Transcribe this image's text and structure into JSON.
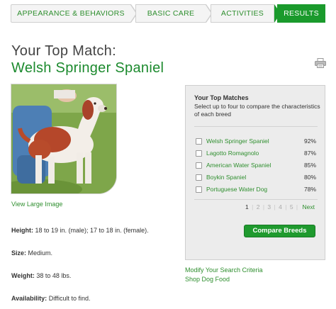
{
  "steps": [
    {
      "label": "Appearance & Behaviors"
    },
    {
      "label": "Basic Care"
    },
    {
      "label": "Activities"
    },
    {
      "label": "Results",
      "active": true
    }
  ],
  "colors": {
    "brand_green": "#1a9a2c",
    "link_green": "#2f8f2f",
    "panel_bg": "#ececec"
  },
  "heading": {
    "line1": "Your Top Match:",
    "line2": "Welsh Springer Spaniel"
  },
  "print_icon": "printer-icon",
  "photo": {
    "alt": "Welsh Springer Spaniel",
    "view_large": "View Large Image"
  },
  "facts": [
    {
      "label": "Height:",
      "value": " 18 to 19 in. (male); 17 to 18 in. (female)."
    },
    {
      "label": "Size:",
      "value": " Medium."
    },
    {
      "label": "Weight:",
      "value": " 38 to 48 lbs."
    },
    {
      "label": "Availability:",
      "value": " Difficult to find."
    }
  ],
  "matches_panel": {
    "title": "Your Top Matches",
    "description": "Select up to four to compare the characteristics of each breed",
    "items": [
      {
        "name": "Welsh Springer Spaniel",
        "pct": "92%"
      },
      {
        "name": "Lagotto Romagnolo",
        "pct": "87%"
      },
      {
        "name": "American Water Spaniel",
        "pct": "85%"
      },
      {
        "name": "Boykin Spaniel",
        "pct": "80%"
      },
      {
        "name": "Portuguese Water Dog",
        "pct": "78%"
      }
    ],
    "pager": {
      "current": "1",
      "pages": [
        "2",
        "3",
        "4",
        "5"
      ],
      "next": "Next"
    },
    "compare_label": "Compare Breeds"
  },
  "links": {
    "modify": "Modify Your Search Criteria",
    "shop": "Shop Dog Food"
  }
}
